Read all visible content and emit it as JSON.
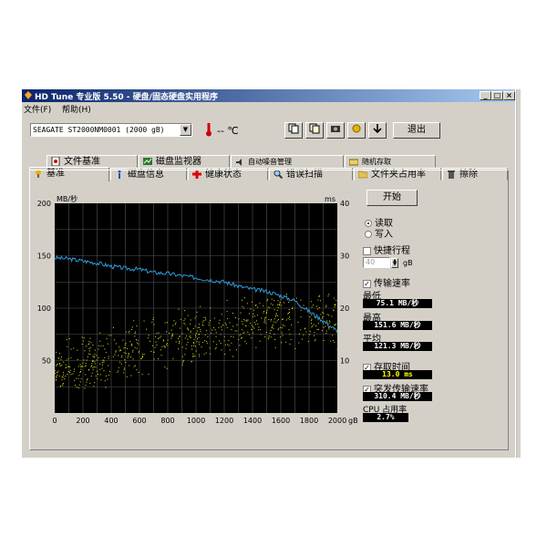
{
  "window": {
    "title": "HD Tune 专业版 5.50 - 硬盘/固态硬盘实用程序"
  },
  "menu": {
    "items": [
      "文件(F)",
      "帮助(H)"
    ]
  },
  "toolbar": {
    "drive": "SEAGATE ST2000NM0001 (2000 gB)",
    "temperature": "-- ℃",
    "exit_label": "退出"
  },
  "tabs_top": [
    "文件基准",
    "磁盘监视器",
    "自动噪音管理",
    "随机存取"
  ],
  "tabs_bottom": [
    "基准",
    "磁盘信息",
    "健康状态",
    "错误扫描",
    "文件夹占用率",
    "擦除"
  ],
  "chart": {
    "left_unit": "MB/秒",
    "right_unit": "ms",
    "x_unit": "gB",
    "start_label": "开始",
    "read_label": "读取",
    "write_label": "写入",
    "short_stroke_label": "快捷行程",
    "short_stroke_value": "40",
    "short_stroke_unit": "gB",
    "transfer_rate_label": "传输速率",
    "min_label": "最低",
    "min_value": "75.1 MB/秒",
    "max_label": "最高",
    "max_value": "151.6 MB/秒",
    "avg_label": "平均",
    "avg_value": "121.3 MB/秒",
    "access_time_label": "存取时间",
    "access_time_value": "13.0 ms",
    "burst_label": "突发传输速率",
    "burst_value": "310.4 MB/秒",
    "cpu_label": "CPU 占用率",
    "cpu_value": "2.7%"
  },
  "chart_data": {
    "type": "line",
    "x_ticks": [
      "0",
      "200",
      "400",
      "600",
      "800",
      "1000",
      "1200",
      "1400",
      "1600",
      "1800",
      "2000"
    ],
    "y_left_ticks": [
      "50",
      "100",
      "150",
      "200"
    ],
    "y_right_ticks": [
      "10",
      "20",
      "30",
      "40"
    ],
    "xlim": [
      0,
      2000
    ],
    "ylim_left": [
      0,
      200
    ],
    "ylim_right": [
      0,
      40
    ],
    "grid": true,
    "series": [
      {
        "axis": "left",
        "color": "#2e9bd6",
        "x": [
          0,
          100,
          200,
          300,
          400,
          500,
          600,
          700,
          800,
          900,
          1000,
          1100,
          1200,
          1300,
          1400,
          1500,
          1600,
          1700,
          1800,
          1900,
          2000
        ],
        "y": [
          148,
          147,
          145,
          143,
          140,
          138,
          137,
          134,
          133,
          131,
          129,
          127,
          125,
          121,
          118,
          116,
          112,
          107,
          97,
          88,
          78
        ]
      },
      {
        "axis": "right",
        "color": "#e6e61a",
        "kind": "scatter",
        "x_range": [
          0,
          2000
        ],
        "trend": [
          [
            0,
            8
          ],
          [
            500,
            12
          ],
          [
            1000,
            15
          ],
          [
            1500,
            18
          ],
          [
            2000,
            18
          ]
        ],
        "spread": 6
      }
    ]
  },
  "colors": {
    "plot_bg": "#000000",
    "grid": "#555555",
    "title_start": "#0a246a",
    "title_end": "#a6caf0",
    "window_bg": "#d4d0c8"
  }
}
